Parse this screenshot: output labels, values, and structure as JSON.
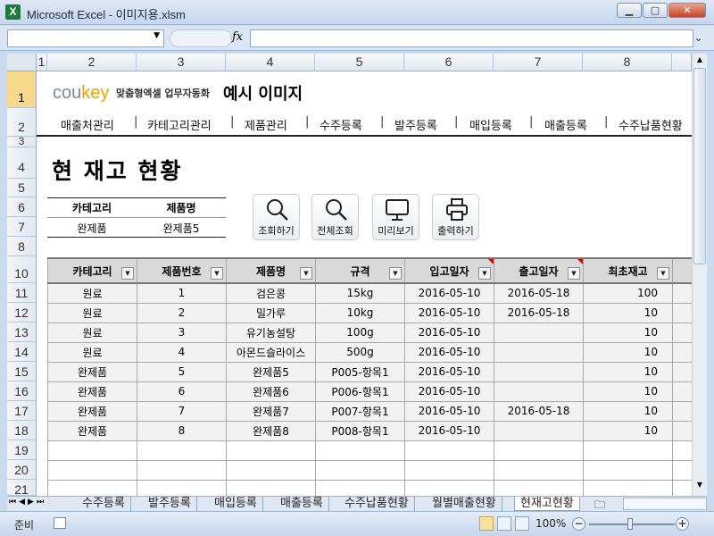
{
  "window": {
    "title": "Microsoft Excel - 이미지용.xlsm",
    "app_icon": "X"
  },
  "formula_bar": {
    "name_box": "",
    "fx": "fx",
    "formula": ""
  },
  "columns": [
    "1",
    "2",
    "3",
    "4",
    "5",
    "6",
    "7",
    "8"
  ],
  "rows": [
    "1",
    "2",
    "3",
    "4",
    "5",
    "6",
    "7",
    "8",
    "10",
    "11",
    "12",
    "13",
    "14",
    "15",
    "16",
    "17",
    "18",
    "19",
    "20",
    "21"
  ],
  "header": {
    "logo_a": "cou",
    "logo_b": "key",
    "logo_sub": "맞춤형엑셀 업무자동화",
    "title": "예시 이미지"
  },
  "menu": [
    "매출처관리",
    "카테고리관리",
    "제품관리",
    "수주등록",
    "발주등록",
    "매입등록",
    "매출등록",
    "수주납품현황"
  ],
  "menu_sep": "|",
  "page_title": "현 재고 현황",
  "filter": {
    "category_label": "카테고리",
    "product_label": "제품명",
    "category_value": "완제품",
    "product_value": "완제품5"
  },
  "buttons": [
    "조회하기",
    "전체조회",
    "미리보기",
    "출력하기"
  ],
  "table": {
    "headers": [
      "카테고리",
      "제품번호",
      "제품명",
      "규격",
      "입고일자",
      "출고일자",
      "최초재고"
    ],
    "rows": [
      [
        "원료",
        "1",
        "검은콩",
        "15kg",
        "2016-05-10",
        "2016-05-18",
        "100"
      ],
      [
        "원료",
        "2",
        "밀가루",
        "10kg",
        "2016-05-10",
        "2016-05-18",
        "10"
      ],
      [
        "원료",
        "3",
        "유기농설탕",
        "100g",
        "2016-05-10",
        "",
        "10"
      ],
      [
        "원료",
        "4",
        "아몬드슬라이스",
        "500g",
        "2016-05-10",
        "",
        "10"
      ],
      [
        "완제품",
        "5",
        "완제품5",
        "P005-항목1",
        "2016-05-10",
        "",
        "10"
      ],
      [
        "완제품",
        "6",
        "완제품6",
        "P006-항목1",
        "2016-05-10",
        "",
        "10"
      ],
      [
        "완제품",
        "7",
        "완제품7",
        "P007-항목1",
        "2016-05-10",
        "2016-05-18",
        "10"
      ],
      [
        "완제품",
        "8",
        "완제품8",
        "P008-항목1",
        "2016-05-10",
        "",
        "10"
      ]
    ]
  },
  "sheet_tabs": [
    "수주등록",
    "발주등록",
    "매입등록",
    "매출등록",
    "수주납품현황",
    "월별매출현황",
    "현재고현황"
  ],
  "active_tab": "현재고현황",
  "status": {
    "ready": "준비",
    "zoom": "100%"
  }
}
